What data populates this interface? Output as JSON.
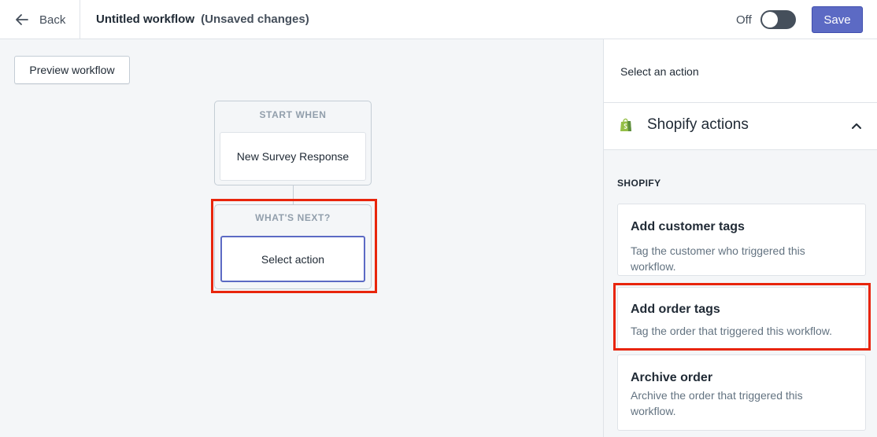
{
  "header": {
    "back_label": "Back",
    "title": "Untitled workflow",
    "status": "(Unsaved changes)",
    "toggle_label": "Off",
    "save_label": "Save"
  },
  "canvas": {
    "preview_label": "Preview workflow",
    "start_node": {
      "header": "START WHEN",
      "trigger": "New Survey Response"
    },
    "next_node": {
      "header": "WHAT'S NEXT?",
      "action": "Select action"
    }
  },
  "panel": {
    "heading": "Select an action",
    "section_title": "Shopify actions",
    "group_label": "SHOPIFY",
    "actions": [
      {
        "title": "Add customer tags",
        "description": "Tag the customer who triggered this workflow."
      },
      {
        "title": "Add order tags",
        "description": "Tag the order that triggered this workflow."
      },
      {
        "title": "Archive order",
        "description": "Archive the order that triggered this workflow."
      }
    ]
  },
  "icons": {
    "back": "arrow-left-icon",
    "section": "shopify-bag-icon",
    "collapse": "chevron-up-icon"
  },
  "colors": {
    "primary": "#5c6ac4",
    "highlight": "#e8250c",
    "shopify_green": "#95bf47"
  }
}
